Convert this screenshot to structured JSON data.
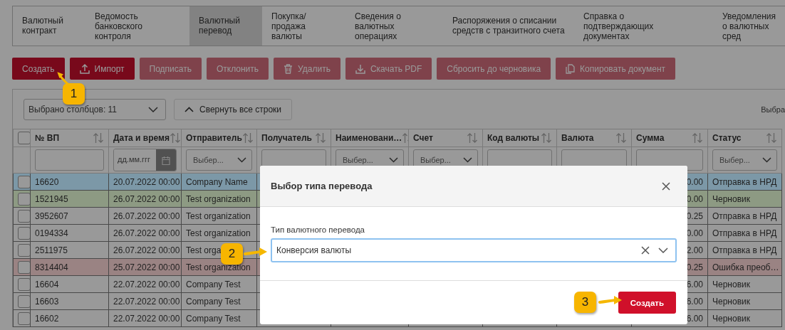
{
  "tabs": [
    {
      "label": "Валютный контракт",
      "selected": false
    },
    {
      "label": "Ведомость банковского контроля",
      "selected": false
    },
    {
      "label": "Валютный перевод",
      "selected": true
    },
    {
      "label": "Покупка/ продажа валюты",
      "selected": false
    },
    {
      "label": "Сведения о валютных операциях",
      "selected": false
    },
    {
      "label": "Распоряжения о списании средств с транзитного счета",
      "selected": false
    },
    {
      "label": "Справка о подтверждающих документах",
      "selected": false
    },
    {
      "label": "Уведомления о валютных сред",
      "selected": false
    }
  ],
  "toolbar": [
    {
      "label": "Создать",
      "kind": "text",
      "disabled": false
    },
    {
      "label": "Импорт",
      "kind": "upload",
      "disabled": false
    },
    {
      "label": "Подписать",
      "kind": "text",
      "disabled": true
    },
    {
      "label": "Отклонить",
      "kind": "text",
      "disabled": true
    },
    {
      "label": "Удалить",
      "kind": "trash",
      "disabled": true
    },
    {
      "label": "Скачать PDF",
      "kind": "download",
      "disabled": true
    },
    {
      "label": "Сбросить до черновика",
      "kind": "text",
      "disabled": true
    },
    {
      "label": "Копировать документ",
      "kind": "copy",
      "disabled": true
    }
  ],
  "column_selector": {
    "value": "Выбрано столбцов: 11"
  },
  "collapse_button": {
    "label": "Свернуть все строки"
  },
  "right_text": "Выбра",
  "table": {
    "select_all_checked": false,
    "columns": [
      {
        "label": "№ ВП",
        "filter": {
          "kind": "input"
        }
      },
      {
        "label": "Дата и время",
        "filter": {
          "kind": "date",
          "placeholder": "дд.мм.ггг"
        }
      },
      {
        "label": "Отправитель",
        "filter": {
          "kind": "select",
          "placeholder": "Выбер..."
        }
      },
      {
        "label": "Получатель",
        "filter": {
          "kind": "input"
        }
      },
      {
        "label": "Наименовани…",
        "filter": {
          "kind": "select",
          "placeholder": "Выбер..."
        }
      },
      {
        "label": "Счет",
        "filter": {
          "kind": "select",
          "placeholder": "Выбер..."
        }
      },
      {
        "label": "Код валюты",
        "filter": {
          "kind": "input"
        }
      },
      {
        "label": "Валюта",
        "filter": {
          "kind": "input"
        }
      },
      {
        "label": "Сумма",
        "filter": {
          "kind": "input"
        }
      },
      {
        "label": "Статус",
        "filter": {
          "kind": "select",
          "placeholder": "Выбер..."
        }
      }
    ],
    "rows": [
      {
        "checked": false,
        "color": "#7c98a7",
        "number": "16620",
        "datetime": "20.07.2022 00:00",
        "sender": "Company Name",
        "amount": "0.00",
        "status": "Отправка в НРД"
      },
      {
        "checked": false,
        "color": "#8d9a83",
        "number": "1521945",
        "datetime": "26.07.2022 00:00",
        "sender": "Test organization",
        "amount": "0.00",
        "status": "Черновик"
      },
      {
        "checked": false,
        "color": "#999999",
        "number": "3952607",
        "datetime": "26.07.2022 00:00",
        "sender": "Test organization",
        "amount": "0.25",
        "status": "Отправка в НРД"
      },
      {
        "checked": false,
        "color": "#999999",
        "number": "0194334",
        "datetime": "26.07.2022 00:00",
        "sender": "Test organization",
        "amount": "0.00",
        "status": "Отправка в НРД"
      },
      {
        "checked": false,
        "color": "#999999",
        "number": "2511975",
        "datetime": "26.07.2022 00:00",
        "sender": "Test orga",
        "amount": "2.00",
        "status": "Отправка в НРД"
      },
      {
        "checked": false,
        "color": "#9a8383",
        "number": "8314404",
        "datetime": "25.07.2022 00:00",
        "sender": "Test organization",
        "amount": "0.25",
        "status": "Ошибка преоб…"
      },
      {
        "checked": false,
        "color": "#999999",
        "number": "16604",
        "datetime": "22.07.2022 00:00",
        "sender": "Company Test",
        "amount": "6.00",
        "status": "Черновик"
      },
      {
        "checked": false,
        "color": "#999999",
        "number": "16603",
        "datetime": "22.07.2022 00:00",
        "sender": "Company Test",
        "amount": "6.00",
        "status": "Черновик"
      },
      {
        "checked": false,
        "color": "#999999",
        "number": "16602",
        "datetime": "22.07.2022 00:00",
        "sender": "Company Test",
        "amount": "6.00",
        "status": "Черновик"
      }
    ]
  },
  "modal": {
    "title": "Выбор типа перевода",
    "field_label": "Тип валютного перевода",
    "field_value": "Конверсия валюты",
    "button": "Создать"
  },
  "callouts": [
    {
      "label": "1"
    },
    {
      "label": "2"
    },
    {
      "label": "3"
    }
  ]
}
